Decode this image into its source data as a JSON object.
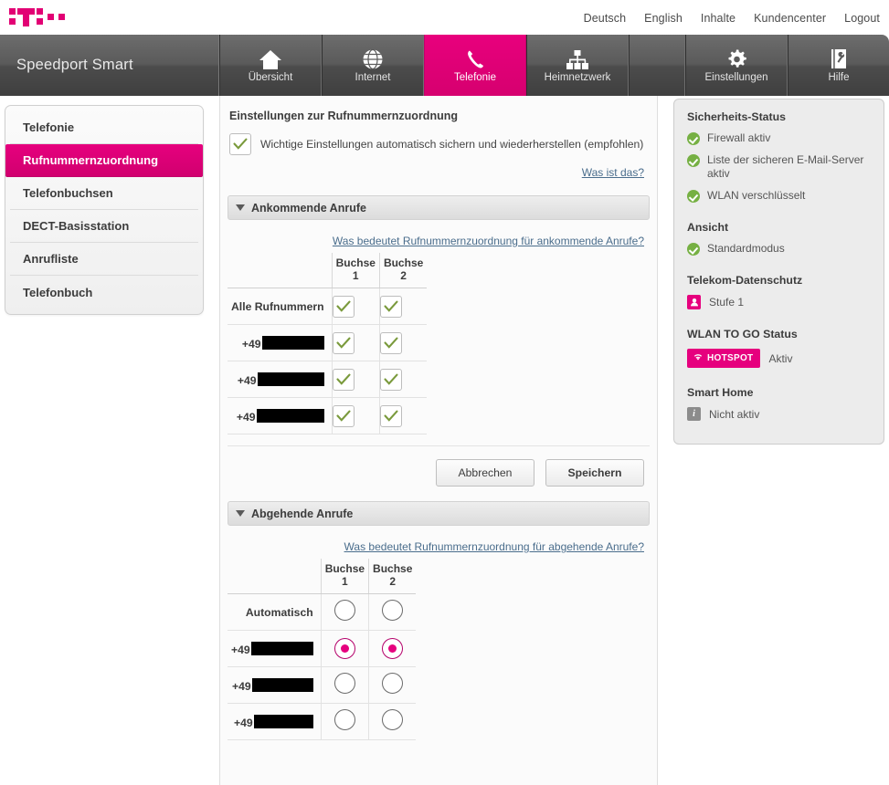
{
  "meta_nav": [
    {
      "label": "Deutsch",
      "name": "meta-nav-deutsch"
    },
    {
      "label": "English",
      "name": "meta-nav-english"
    },
    {
      "label": "Inhalte",
      "name": "meta-nav-inhalte"
    },
    {
      "label": "Kundencenter",
      "name": "meta-nav-kundencenter"
    },
    {
      "label": "Logout",
      "name": "meta-nav-logout"
    }
  ],
  "brand": {
    "title": "Speedport Smart",
    "logo": "telekom-t-logo"
  },
  "main_nav": [
    {
      "label": "Übersicht",
      "icon": "home-icon",
      "active": false
    },
    {
      "label": "Internet",
      "icon": "globe-icon",
      "active": false
    },
    {
      "label": "Telefonie",
      "icon": "phone-handset-icon",
      "active": true
    },
    {
      "label": "Heimnetzwerk",
      "icon": "network-tree-icon",
      "active": false
    },
    {
      "label": "Einstellungen",
      "icon": "gear-icon",
      "active": false
    },
    {
      "label": "Hilfe",
      "icon": "manual-wrench-icon",
      "active": false
    }
  ],
  "sidebar": {
    "items": [
      {
        "label": "Telefonie",
        "active": false
      },
      {
        "label": "Rufnummernzuordnung",
        "active": true
      },
      {
        "label": "Telefonbuchsen",
        "active": false
      },
      {
        "label": "DECT-Basisstation",
        "active": false
      },
      {
        "label": "Anrufliste",
        "active": false
      },
      {
        "label": "Telefonbuch",
        "active": false
      }
    ]
  },
  "content": {
    "title": "Einstellungen zur Rufnummernzuordnung",
    "autosave": {
      "label": "Wichtige Einstellungen automatisch sichern und wiederherstellen (empfohlen)",
      "checked": true
    },
    "what_is_this": "Was ist das?",
    "incoming": {
      "section_label": "Ankommende Anrufe",
      "help_link": "Was bedeutet Rufnummernzuordnung für ankommende Anrufe?",
      "columns": [
        "Buchse 1",
        "Buchse 2"
      ],
      "rows": [
        {
          "label": "Alle Rufnummern",
          "redacted": false,
          "redact_width": 0,
          "checks": [
            true,
            true
          ]
        },
        {
          "label": "+49",
          "redacted": true,
          "redact_width": 68,
          "checks": [
            true,
            true
          ]
        },
        {
          "label": "+49",
          "redacted": true,
          "redact_width": 73,
          "checks": [
            true,
            true
          ]
        },
        {
          "label": "+49",
          "redacted": true,
          "redact_width": 74,
          "checks": [
            true,
            true
          ]
        }
      ]
    },
    "buttons": {
      "cancel": "Abbrechen",
      "save": "Speichern"
    },
    "outgoing": {
      "section_label": "Abgehende Anrufe",
      "help_link": "Was bedeutet Rufnummernzuordnung für abgehende Anrufe?",
      "columns": [
        "Buchse 1",
        "Buchse 2"
      ],
      "rows": [
        {
          "label": "Automatisch",
          "redacted": false,
          "redact_width": 0,
          "radios": [
            false,
            false
          ]
        },
        {
          "label": "+49",
          "redacted": true,
          "redact_width": 68,
          "radios": [
            true,
            true
          ]
        },
        {
          "label": "+49",
          "redacted": true,
          "redact_width": 67,
          "radios": [
            false,
            false
          ]
        },
        {
          "label": "+49",
          "redacted": true,
          "redact_width": 65,
          "radios": [
            false,
            false
          ]
        }
      ]
    }
  },
  "status_panel": {
    "security_title": "Sicherheits-Status",
    "security_items": [
      "Firewall aktiv",
      "Liste der sicheren E-Mail-Server aktiv",
      "WLAN verschlüsselt"
    ],
    "view_title": "Ansicht",
    "view_value": "Standardmodus",
    "privacy_title": "Telekom-Datenschutz",
    "privacy_value": "Stufe 1",
    "wlan_togo_title": "WLAN TO GO Status",
    "wlan_togo_badge": "HOTSPOT",
    "wlan_togo_value": "Aktiv",
    "smart_home_title": "Smart Home",
    "smart_home_value": "Nicht aktiv"
  },
  "colors": {
    "magenta": "#e6007e",
    "nav_dark": "#5a5a5a",
    "green_ok": "#76b043",
    "link_blue": "#4a6d8c"
  }
}
